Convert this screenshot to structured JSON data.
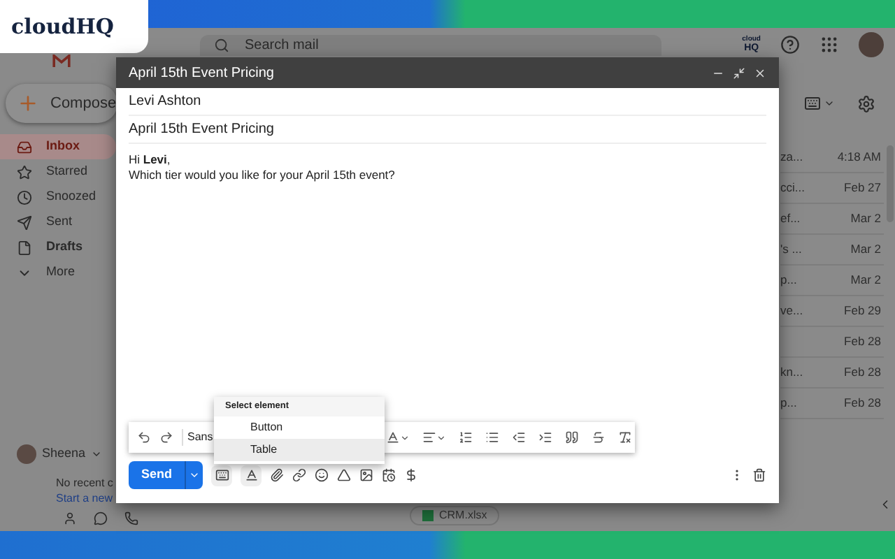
{
  "brand_badge": {
    "text": "cloudHQ"
  },
  "gmail": {
    "search": {
      "placeholder": "Search mail"
    },
    "header_badge": {
      "line_1": "cloud",
      "line_2": "HQ"
    },
    "compose_button": "Compose",
    "nav": [
      {
        "label": "Inbox",
        "kind": "inbox",
        "selected": true,
        "bold": true
      },
      {
        "label": "Starred",
        "kind": "star",
        "selected": false,
        "bold": false
      },
      {
        "label": "Snoozed",
        "kind": "clock",
        "selected": false,
        "bold": false
      },
      {
        "label": "Sent",
        "kind": "send",
        "selected": false,
        "bold": false
      },
      {
        "label": "Drafts",
        "kind": "file",
        "selected": false,
        "bold": true
      },
      {
        "label": "More",
        "kind": "more",
        "selected": false,
        "bold": false
      }
    ],
    "account": {
      "name": "Sheena"
    },
    "hangouts": {
      "text": "No recent c",
      "link": "Start a new"
    },
    "mail_rows": [
      {
        "snippet": "za...",
        "date": "4:18 AM"
      },
      {
        "snippet": "cci...",
        "date": "Feb 27"
      },
      {
        "snippet": "ef...",
        "date": "Mar 2"
      },
      {
        "snippet": "'s ...",
        "date": "Mar 2"
      },
      {
        "snippet": "p...",
        "date": "Mar 2"
      },
      {
        "snippet": "ve...",
        "date": "Feb 29"
      },
      {
        "snippet": "",
        "date": "Feb 28"
      },
      {
        "snippet": "kn...",
        "date": "Feb 28"
      },
      {
        "snippet": "p...",
        "date": "Feb 28"
      }
    ],
    "attachment_chip": "CRM.xlsx"
  },
  "compose": {
    "title": "April 15th Event Pricing",
    "to": "Levi Ashton",
    "subject": "April 15th Event Pricing",
    "body": [
      "Hi **Levi**,",
      "Which tier would you like for your April 15th event?"
    ],
    "font": "Sans",
    "send": "Send",
    "menu": {
      "title": "Select element",
      "items": [
        {
          "label": "Button",
          "selected": false
        },
        {
          "label": "Table",
          "selected": true
        }
      ]
    }
  }
}
